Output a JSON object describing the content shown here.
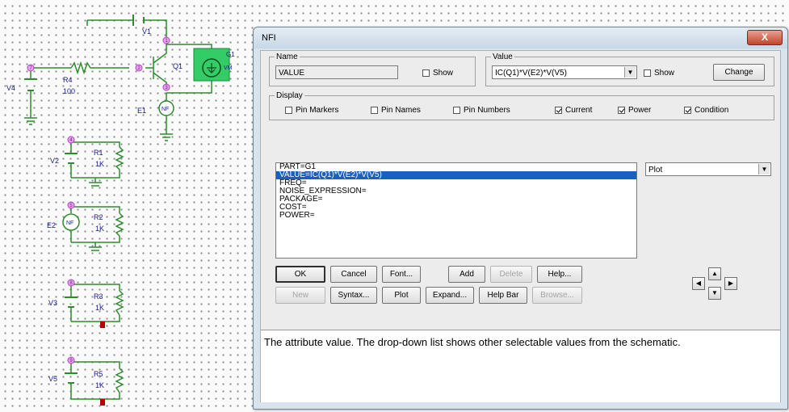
{
  "schematic": {
    "labels": {
      "v1": "V1",
      "q1": "Q1",
      "g1": "G1",
      "g1_sub": "VM",
      "v4": "V4",
      "r4": "R4",
      "r4_val": "100",
      "e1": "E1",
      "nf": "NF",
      "v2": "V2",
      "r1": "R1",
      "r1_val": "1K",
      "e2": "E2",
      "r2": "R2",
      "r2_val": "1K",
      "v3": "V3",
      "r3": "R3",
      "r3_val": "1K",
      "v5": "V5",
      "r5": "R5",
      "r5_val": "1K",
      "n1": "1",
      "n2": "2",
      "n3": "3",
      "n4": "4",
      "n5": "5",
      "n6": "6",
      "n7": "7",
      "n8": "8",
      "n9": "9"
    }
  },
  "dialog": {
    "title": "NFI",
    "close_label": "X",
    "name_group": "Name",
    "name_value": "VALUE",
    "name_show_label": "Show",
    "value_group": "Value",
    "value_value": "IC(Q1)*V(E2)*V(V5)",
    "value_show_label": "Show",
    "change_label": "Change",
    "display_group": "Display",
    "display_options": [
      {
        "label": "Pin Markers",
        "checked": false
      },
      {
        "label": "Pin Names",
        "checked": false
      },
      {
        "label": "Pin Numbers",
        "checked": false
      },
      {
        "label": "Current",
        "checked": true
      },
      {
        "label": "Power",
        "checked": true
      },
      {
        "label": "Condition",
        "checked": true
      }
    ],
    "attributes": [
      "PART=G1",
      "VALUE=IC(Q1)*V(E2)*V(V5)",
      "FREQ=",
      "NOISE_EXPRESSION=",
      "PACKAGE=",
      "COST=",
      "POWER="
    ],
    "selected_attribute_index": 1,
    "plot_select_value": "Plot",
    "buttons_row1": [
      "OK",
      "Cancel",
      "Font...",
      "Add",
      "Delete",
      "Help..."
    ],
    "buttons_row2": [
      "New",
      "Syntax...",
      "Plot",
      "Expand...",
      "Help Bar",
      "Browse..."
    ],
    "disabled_buttons": [
      "Delete",
      "New",
      "Browse..."
    ],
    "help_text": "The attribute value. The drop-down list shows other selectable values from the schematic."
  },
  "colors": {
    "wire": "#2e8b2e",
    "node": "#b73ac9",
    "ground": "#b40000",
    "meter_fill": "#33cc66",
    "selection": "#1a5fc2"
  },
  "icons": [
    "close-icon",
    "dropdown-arrow-icon",
    "arrow-up-icon",
    "arrow-down-icon",
    "arrow-left-icon",
    "arrow-right-icon"
  ]
}
